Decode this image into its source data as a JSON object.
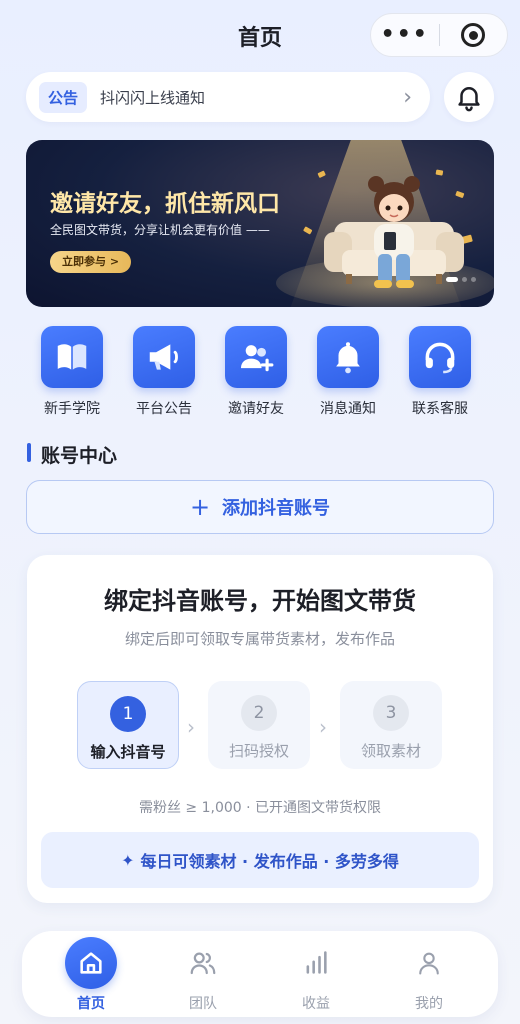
{
  "header": {
    "title": "首页",
    "more_icon": "more-dots-icon",
    "close_icon": "target-icon"
  },
  "notice": {
    "tag": "公告",
    "text": "抖闪闪上线通知",
    "arrow": "›"
  },
  "banner": {
    "title": "邀请好友，抓住新风口",
    "subtitle": "全民图文带货，分享让机会更有价值 ——",
    "button": "立即参与 >"
  },
  "quick_nav": [
    {
      "label": "新手学院",
      "icon": "book-icon"
    },
    {
      "label": "平台公告",
      "icon": "megaphone-icon"
    },
    {
      "label": "邀请好友",
      "icon": "invite-user-icon"
    },
    {
      "label": "消息通知",
      "icon": "bell-icon"
    },
    {
      "label": "联系客服",
      "icon": "headset-icon"
    }
  ],
  "account": {
    "section_title": "账号中心",
    "add_button": "添加抖音账号",
    "add_icon": "+"
  },
  "bind_card": {
    "title": "绑定抖音账号，开始图文带货",
    "subtitle": "绑定后即可领取专属带货素材，发布作品",
    "steps": [
      {
        "num": "1",
        "label": "输入抖音号"
      },
      {
        "num": "2",
        "label": "扫码授权"
      },
      {
        "num": "3",
        "label": "领取素材"
      }
    ],
    "note": "需粉丝 ≥ 1,000 · 已开通图文带货权限",
    "benefit": "每日可领素材 · 发布作品 · 多劳多得",
    "benefit_icon": "✦"
  },
  "tabbar": [
    {
      "label": "首页",
      "icon": "home-icon",
      "active": true
    },
    {
      "label": "团队",
      "icon": "team-icon"
    },
    {
      "label": "收益",
      "icon": "chart-bars-icon"
    },
    {
      "label": "我的",
      "icon": "profile-icon"
    }
  ],
  "colors": {
    "primary": "#3461e0",
    "banner_bg": "#15203f",
    "gold": "#ffe7a8"
  }
}
